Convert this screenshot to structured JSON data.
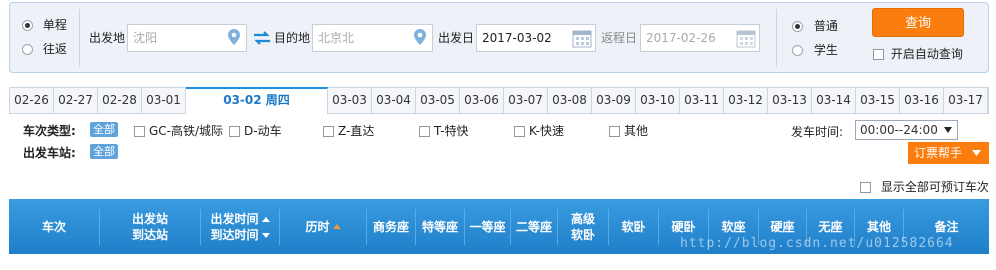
{
  "trip_type": {
    "one_way": "单程",
    "round_trip": "往返",
    "selected": "单程"
  },
  "from": {
    "label": "出发地",
    "placeholder": "沈阳"
  },
  "to": {
    "label": "目的地",
    "placeholder": "北京北"
  },
  "depart_date": {
    "label": "出发日",
    "value": "2017-03-02"
  },
  "return_date": {
    "label": "返程日",
    "value": "2017-02-26"
  },
  "passenger": {
    "normal": "普通",
    "student": "学生",
    "selected": "普通"
  },
  "query_button": "查询",
  "auto_query": "开启自动查询",
  "date_tabs": [
    "02-26",
    "02-27",
    "02-28",
    "03-01",
    "03-02 周四",
    "03-03",
    "03-04",
    "03-05",
    "03-06",
    "03-07",
    "03-08",
    "03-09",
    "03-10",
    "03-11",
    "03-12",
    "03-13",
    "03-14",
    "03-15",
    "03-16",
    "03-17"
  ],
  "active_tab": "03-02 周四",
  "filters": {
    "train_type_label": "车次类型:",
    "all": "全部",
    "types": [
      "GC-高铁/城际",
      "D-动车",
      "Z-直达",
      "T-特快",
      "K-快速",
      "其他"
    ],
    "station_label": "出发车站:",
    "station_all": "全部",
    "time_label": "发车时间:",
    "time_value": "00:00--24:00"
  },
  "helper_button": "订票帮手",
  "show_all": "显示全部可预订车次",
  "columns": {
    "train_no": "车次",
    "from_station": "出发站",
    "to_station": "到达站",
    "depart_time": "出发时间",
    "arrive_time": "到达时间",
    "duration": "历时",
    "business": "商务座",
    "special": "特等座",
    "first": "一等座",
    "second": "二等座",
    "premium_sleeper_1": "高级",
    "premium_sleeper_2": "软卧",
    "soft_sleeper": "软卧",
    "hard_sleeper": "硬卧",
    "soft_seat": "软座",
    "hard_seat": "硬座",
    "no_seat": "无座",
    "other": "其他",
    "remark": "备注"
  },
  "watermark": "http://blog.csdn.net/u012582664",
  "colors": {
    "accent": "#fa7d0d",
    "header": "#2a8fd8",
    "active_tab_text": "#1b7ac8"
  }
}
